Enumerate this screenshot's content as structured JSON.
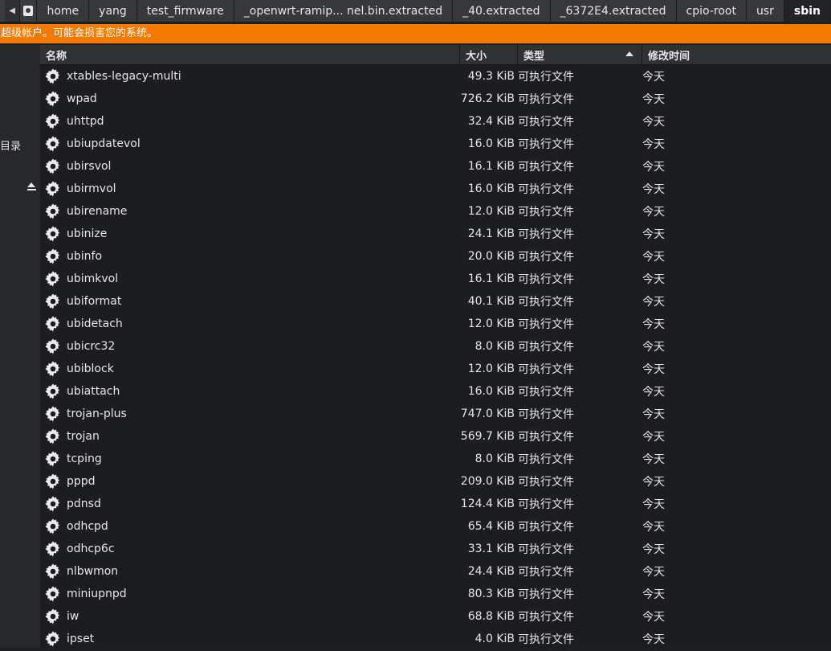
{
  "pathbar": {
    "crumbs": [
      "home",
      "yang",
      "test_firmware",
      "_openwrt-ramip... nel.bin.extracted",
      "_40.extracted",
      "_6372E4.extracted",
      "cpio-root",
      "usr",
      "sbin"
    ]
  },
  "warning": "超级帐户。可能会损害您的系统。",
  "sidebar": {
    "label": "目录"
  },
  "columns": {
    "name": "名称",
    "size": "大小",
    "type": "类型",
    "mtime": "修改时间"
  },
  "files": [
    {
      "name": "xtables-legacy-multi",
      "size": "49.3 KiB",
      "type": "可执行文件",
      "mtime": "今天"
    },
    {
      "name": "wpad",
      "size": "726.2 KiB",
      "type": "可执行文件",
      "mtime": "今天"
    },
    {
      "name": "uhttpd",
      "size": "32.4 KiB",
      "type": "可执行文件",
      "mtime": "今天"
    },
    {
      "name": "ubiupdatevol",
      "size": "16.0 KiB",
      "type": "可执行文件",
      "mtime": "今天"
    },
    {
      "name": "ubirsvol",
      "size": "16.1 KiB",
      "type": "可执行文件",
      "mtime": "今天"
    },
    {
      "name": "ubirmvol",
      "size": "16.0 KiB",
      "type": "可执行文件",
      "mtime": "今天"
    },
    {
      "name": "ubirename",
      "size": "12.0 KiB",
      "type": "可执行文件",
      "mtime": "今天"
    },
    {
      "name": "ubinize",
      "size": "24.1 KiB",
      "type": "可执行文件",
      "mtime": "今天"
    },
    {
      "name": "ubinfo",
      "size": "20.0 KiB",
      "type": "可执行文件",
      "mtime": "今天"
    },
    {
      "name": "ubimkvol",
      "size": "16.1 KiB",
      "type": "可执行文件",
      "mtime": "今天"
    },
    {
      "name": "ubiformat",
      "size": "40.1 KiB",
      "type": "可执行文件",
      "mtime": "今天"
    },
    {
      "name": "ubidetach",
      "size": "12.0 KiB",
      "type": "可执行文件",
      "mtime": "今天"
    },
    {
      "name": "ubicrc32",
      "size": "8.0 KiB",
      "type": "可执行文件",
      "mtime": "今天"
    },
    {
      "name": "ubiblock",
      "size": "12.0 KiB",
      "type": "可执行文件",
      "mtime": "今天"
    },
    {
      "name": "ubiattach",
      "size": "16.0 KiB",
      "type": "可执行文件",
      "mtime": "今天"
    },
    {
      "name": "trojan-plus",
      "size": "747.0 KiB",
      "type": "可执行文件",
      "mtime": "今天"
    },
    {
      "name": "trojan",
      "size": "569.7 KiB",
      "type": "可执行文件",
      "mtime": "今天"
    },
    {
      "name": "tcping",
      "size": "8.0 KiB",
      "type": "可执行文件",
      "mtime": "今天"
    },
    {
      "name": "pppd",
      "size": "209.0 KiB",
      "type": "可执行文件",
      "mtime": "今天"
    },
    {
      "name": "pdnsd",
      "size": "124.4 KiB",
      "type": "可执行文件",
      "mtime": "今天"
    },
    {
      "name": "odhcpd",
      "size": "65.4 KiB",
      "type": "可执行文件",
      "mtime": "今天"
    },
    {
      "name": "odhcp6c",
      "size": "33.1 KiB",
      "type": "可执行文件",
      "mtime": "今天"
    },
    {
      "name": "nlbwmon",
      "size": "24.4 KiB",
      "type": "可执行文件",
      "mtime": "今天"
    },
    {
      "name": "miniupnpd",
      "size": "80.3 KiB",
      "type": "可执行文件",
      "mtime": "今天"
    },
    {
      "name": "iw",
      "size": "68.8 KiB",
      "type": "可执行文件",
      "mtime": "今天"
    },
    {
      "name": "ipset",
      "size": "4.0 KiB",
      "type": "可执行文件",
      "mtime": "今天"
    }
  ],
  "icons": {
    "file": "executable-gear-icon",
    "back": "back-arrow-icon",
    "drive": "drive-icon",
    "eject": "eject-icon",
    "sort": "sort-ascending-icon"
  },
  "colors": {
    "warning_bg": "#f57900",
    "background": "#1c1d20",
    "header_bg": "#303134",
    "text": "#e6e6e6"
  }
}
